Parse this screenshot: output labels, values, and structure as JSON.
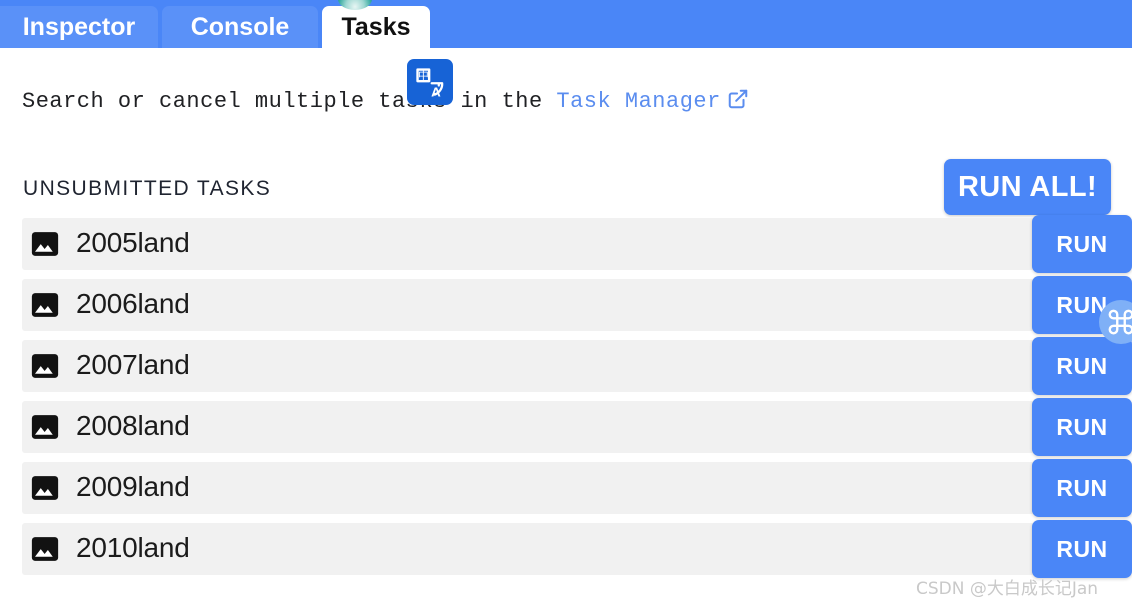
{
  "window": {
    "accent_blue": "#4a86f7",
    "tab_inactive_blue": "#5a91f8",
    "row_gray": "#f1f1f1",
    "link_blue": "#5b8def",
    "translate_badge_blue": "#1763d6"
  },
  "tabs": [
    {
      "label": "Inspector",
      "active": false
    },
    {
      "label": "Console",
      "active": false
    },
    {
      "label": "Tasks",
      "active": true
    }
  ],
  "description": {
    "before": "Search or cancel multiple tasks in the ",
    "link_text": "Task Manager",
    "link_icon": "external-link-icon"
  },
  "section": {
    "title": "UNSUBMITTED TASKS",
    "run_all_label": "RUN ALL!"
  },
  "tasks": [
    {
      "icon": "image-icon",
      "name": "2005land",
      "action_label": "RUN"
    },
    {
      "icon": "image-icon",
      "name": "2006land",
      "action_label": "RUN"
    },
    {
      "icon": "image-icon",
      "name": "2007land",
      "action_label": "RUN"
    },
    {
      "icon": "image-icon",
      "name": "2008land",
      "action_label": "RUN"
    },
    {
      "icon": "image-icon",
      "name": "2009land",
      "action_label": "RUN"
    },
    {
      "icon": "image-icon",
      "name": "2010land",
      "action_label": "RUN"
    }
  ],
  "overlays": {
    "translate_badge": {
      "icon": "translate-icon",
      "cn_glyph": "中",
      "latin_glyph": "A"
    },
    "command_badge": {
      "icon": "command-icon",
      "glyph": "⌘"
    },
    "status_dot": {
      "icon": "status-dot-icon"
    }
  },
  "watermark": {
    "text": "CSDN @大白成长记Jan"
  }
}
